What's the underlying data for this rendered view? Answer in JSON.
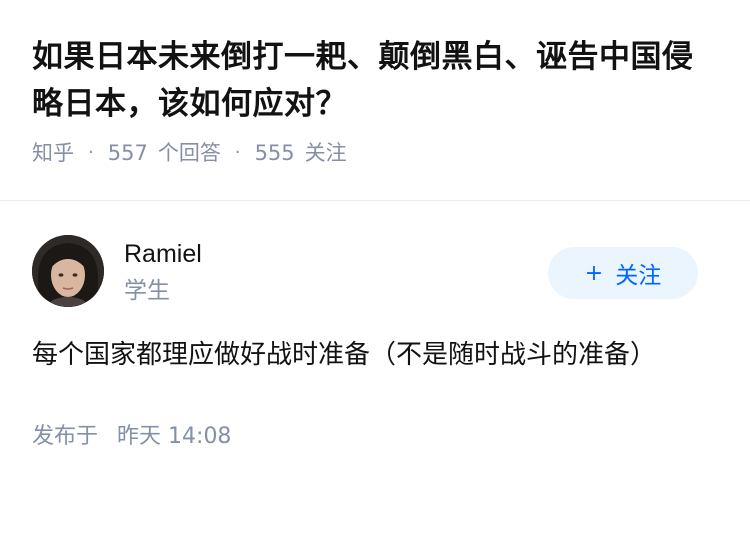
{
  "question": {
    "title": "如果日本未来倒打一耙、颠倒黑白、诬告中国侵略日本，该如何应对？",
    "source": "知乎",
    "answer_count": "557",
    "answer_label": "个回答",
    "follower_count": "555",
    "follower_label": "关注"
  },
  "answer": {
    "author": {
      "name": "Ramiel",
      "bio": "学生",
      "follow_label": "关注",
      "follow_icon": "plus-icon"
    },
    "content": "每个国家都理应做好战时准备（不是随时战斗的准备）",
    "published_prefix": "发布于",
    "published_day": "昨天",
    "published_time": "14:08"
  },
  "colors": {
    "text_primary": "#121212",
    "text_secondary": "#8590a6",
    "accent": "#0066ff",
    "follow_bg": "#ebf5fd",
    "divider": "#ebebeb"
  }
}
